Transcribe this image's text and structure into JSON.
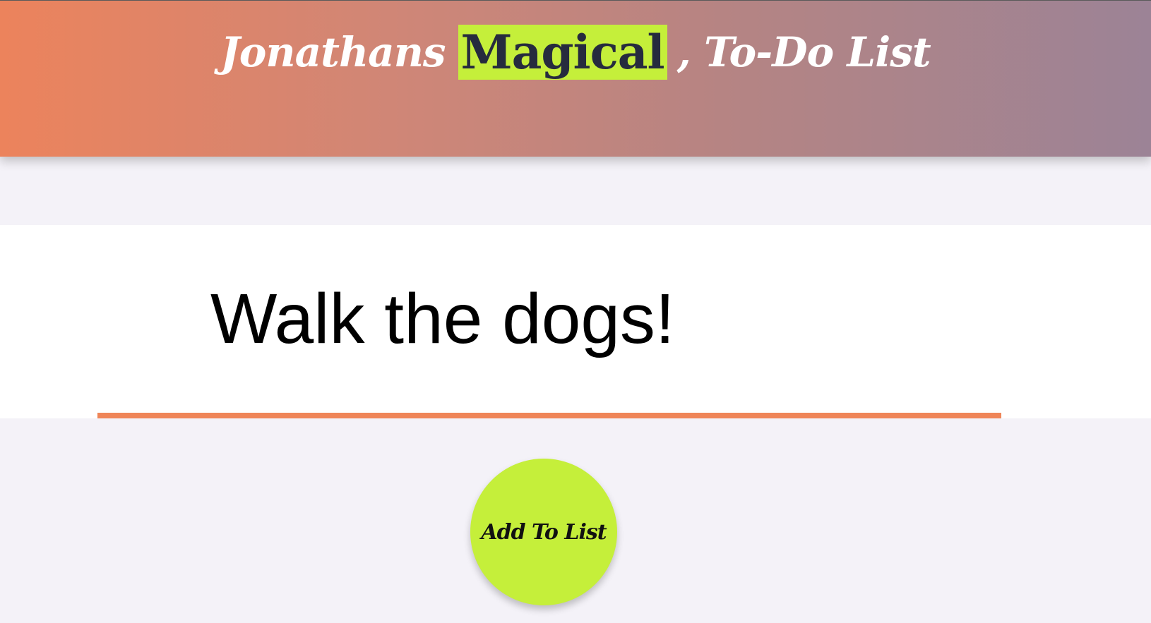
{
  "header": {
    "title_before": "Jonathans",
    "title_highlight": "Magical",
    "title_after": ", To-Do List"
  },
  "todo_input": {
    "value": "Walk the dogs!"
  },
  "add_button": {
    "label": "Add To List"
  },
  "colors": {
    "header_gradient_start": "#ec835c",
    "header_gradient_end": "#9c8396",
    "highlight": "#c5ef3a",
    "highlight_text": "#262b3e",
    "underline": "#ef8558",
    "background": "#f4f2f8"
  }
}
